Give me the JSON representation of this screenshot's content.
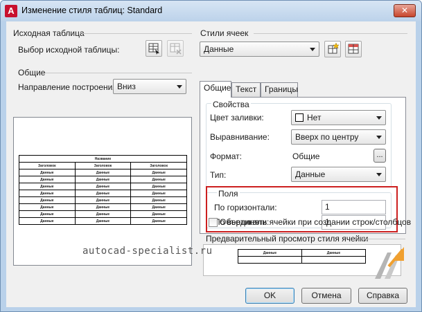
{
  "window": {
    "title": "Изменение стиля таблиц: Standard",
    "app_icon": "A",
    "close_glyph": "✕"
  },
  "source_table": {
    "group_label": "Исходная таблица",
    "select_label": "Выбор исходной таблицы:"
  },
  "general": {
    "group_label": "Общие",
    "direction_label": "Направление построения:",
    "direction_value": "Вниз"
  },
  "preview_table": {
    "header": "Название",
    "columns": [
      "Заголовок",
      "Заголовок",
      "Заголовок"
    ],
    "cell": "Данные",
    "row_count": 8
  },
  "cell_styles": {
    "group_label": "Стили ячеек",
    "selected": "Данные"
  },
  "tabs": [
    "Общие",
    "Текст",
    "Границы"
  ],
  "properties": {
    "group_label": "Свойства",
    "fill_color_label": "Цвет заливки:",
    "fill_color_value": "Нет",
    "alignment_label": "Выравнивание:",
    "alignment_value": "Вверх по центру",
    "format_label": "Формат:",
    "format_value": "Общие",
    "format_button": "...",
    "type_label": "Тип:",
    "type_value": "Данные"
  },
  "margins": {
    "group_label": "Поля",
    "horizontal_label": "По горизонтали:",
    "horizontal_value": "1",
    "vertical_label": "По вертикали:",
    "vertical_value": "1"
  },
  "merge_checkbox": {
    "label": "Объединять ячейки при создании строк/столбцов",
    "checked": false
  },
  "cell_preview": {
    "group_label": "Предварительный просмотр стиля ячейки",
    "cell": "Данные"
  },
  "watermark": "autocad-specialist.ru",
  "buttons": {
    "ok": "OK",
    "cancel": "Отмена",
    "help": "Справка"
  },
  "colors": {
    "highlight_box": "#cc1f1f",
    "title_bar": "#bcd2ea",
    "dialog_bg": "#f0f0f0"
  }
}
